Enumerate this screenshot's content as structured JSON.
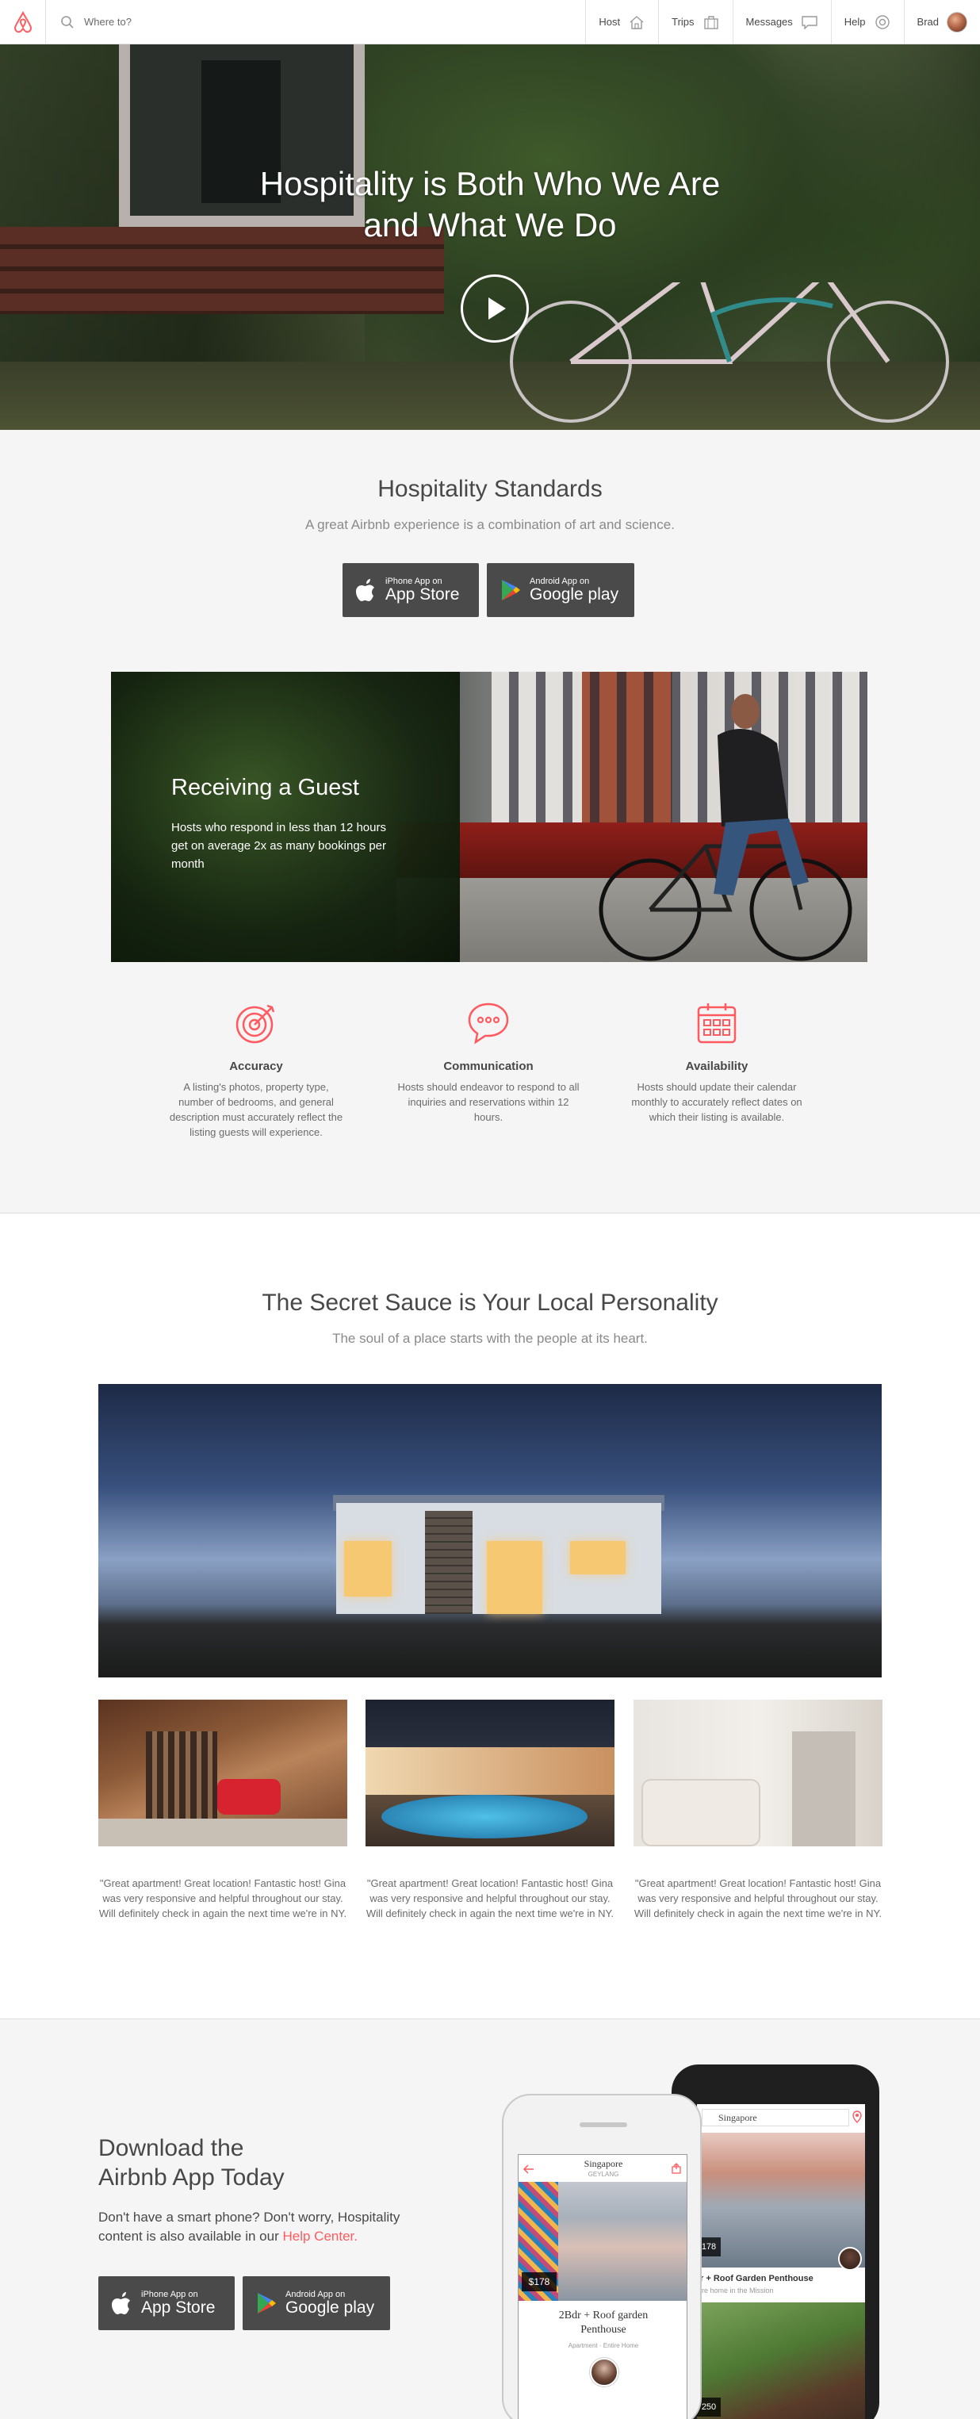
{
  "header": {
    "search_placeholder": "Where to?",
    "nav": [
      "Host",
      "Trips",
      "Messages",
      "Help",
      "Brad"
    ]
  },
  "hero": {
    "title_line1": "Hospitality is Both Who We Are",
    "title_line2": "and What We Do"
  },
  "standards": {
    "title": "Hospitality Standards",
    "subtitle": "A great Airbnb experience is a combination of art and science.",
    "app_store": {
      "small": "iPhone App on",
      "big": "App Store"
    },
    "google_play": {
      "small": "Android App on",
      "big": "Google play"
    },
    "guest": {
      "title": "Receiving a Guest",
      "text": "Hosts who respond in less than 12 hours get on average 2x as many bookings per month"
    },
    "features": [
      {
        "icon": "target-icon",
        "title": "Accuracy",
        "text": "A listing's photos, property type, number of bedrooms, and general description must accurately reflect the listing guests will experience."
      },
      {
        "icon": "chat-bubble-icon",
        "title": "Communication",
        "text": "Hosts should endeavor to respond to all inquiries and reservations within 12 hours."
      },
      {
        "icon": "calendar-icon",
        "title": "Availability",
        "text": "Hosts should update their calendar monthly to accurately reflect dates on which their listing is available."
      }
    ]
  },
  "sauce": {
    "title": "The Secret Sauce is Your Local Personality",
    "subtitle": "The soul of a place starts with the people at its heart.",
    "quotes": [
      "\"Great apartment! Great location! Fantastic host! Gina was very responsive and helpful throughout our stay. Will definitely check in again the next time we're in NY.",
      "\"Great apartment! Great location! Fantastic host! Gina was very responsive and helpful throughout our stay. Will definitely check in again the next time we're in NY.",
      "\"Great apartment! Great location! Fantastic host! Gina was very responsive and helpful throughout our stay. Will definitely check in again the next time we're in NY."
    ]
  },
  "app": {
    "title_line1": "Download the",
    "title_line2": "Airbnb App Today",
    "text": "Don't have a smart phone? Don't worry, Hospitality content is also available in our",
    "link": "Help Center.",
    "app_store": {
      "small": "iPhone App on",
      "big": "App Store"
    },
    "google_play": {
      "small": "Android App on",
      "big": "Google play"
    },
    "front_phone": {
      "city": "Singapore",
      "district": "GEYLANG",
      "price": "$178",
      "listing": "2Bdr + Roof garden Penthouse",
      "meta": "Apartment · Entire Home"
    },
    "back_phone": {
      "search": "Singapore",
      "price": "178",
      "price2": "250",
      "listing": "r + Roof Garden Penthouse",
      "meta": "ire home in the Mission"
    }
  },
  "colors": {
    "brand": "#ff5a5f",
    "text": "#484848",
    "muted": "#8a8a8a"
  }
}
